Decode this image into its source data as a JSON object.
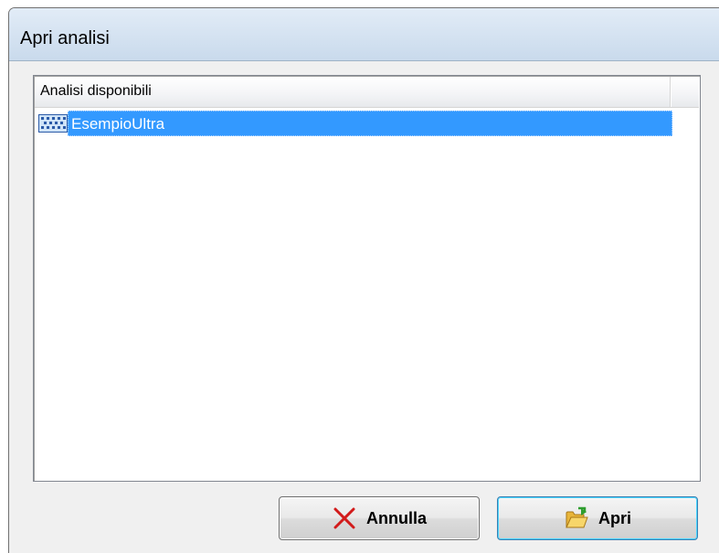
{
  "window": {
    "title": "Apri analisi"
  },
  "list": {
    "column_header": "Analisi disponibili",
    "items": [
      {
        "label": "EsempioUltra",
        "selected": true,
        "icon": "grid-icon"
      }
    ]
  },
  "buttons": {
    "cancel": {
      "label": "Annulla",
      "icon": "x-icon"
    },
    "open": {
      "label": "Apri",
      "icon": "open-folder-icon"
    }
  },
  "colors": {
    "selection": "#3399ff",
    "cancel_icon": "#d21b1b",
    "folder_icon": "#f2c94c"
  }
}
